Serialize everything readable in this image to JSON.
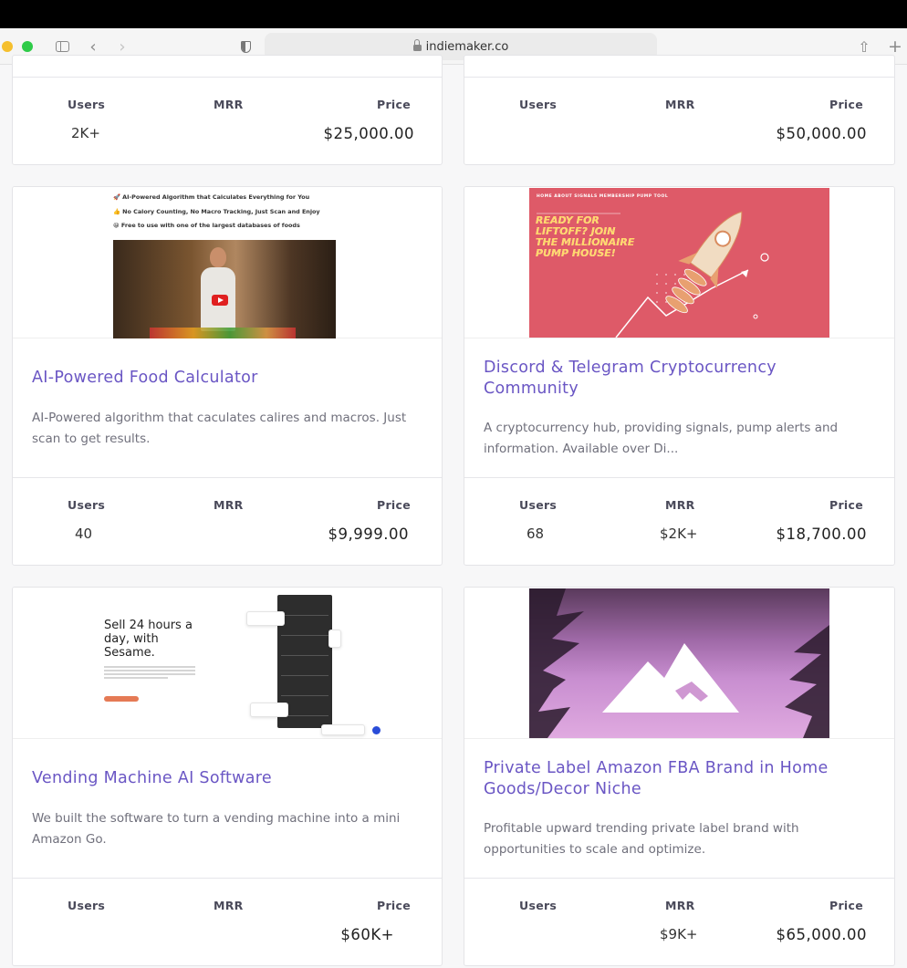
{
  "browser": {
    "url": "indiemaker.co",
    "icons": [
      "sidebar-icon",
      "back-icon",
      "forward-icon",
      "shield-icon",
      "lock-icon",
      "reload-icon",
      "share-icon",
      "new-tab-icon"
    ]
  },
  "stat_labels": {
    "users": "Users",
    "mrr": "MRR",
    "price": "Price"
  },
  "listings": [
    {
      "title": "",
      "description": "",
      "users": "2K+",
      "mrr": "",
      "price": "$25,000.00"
    },
    {
      "title": "",
      "description": "",
      "users": "",
      "mrr": "",
      "price": "$50,000.00"
    },
    {
      "title": "AI-Powered Food Calculator",
      "description": "AI-Powered algorithm that caculates calires and macros. Just scan to get results.",
      "users": "40",
      "mrr": "",
      "price": "$9,999.00",
      "image": {
        "lines": [
          "🚀 AI-Powered Algorithm that Calculates Everything for You",
          "👍 No Calory Counting, No Macro Tracking, Just Scan and Enjoy",
          "😀 Free to use with one of the largest databases of foods"
        ]
      }
    },
    {
      "title": "Discord & Telegram Cryptocurrency Community",
      "description": "A cryptocurrency hub, providing signals, pump alerts and information. Available over Di...",
      "users": "68",
      "mrr": "$2K+",
      "price": "$18,700.00",
      "image": {
        "nav": "HOME    ABOUT    SIGNALS    MEMBERSHIP    PUMP TOOL",
        "headline_lines": [
          "READY FOR",
          "LIFTOFF? JOIN",
          "THE MILLIONAIRE",
          "PUMP HOUSE!"
        ]
      }
    },
    {
      "title": "Vending Machine AI Software",
      "description": "We built the software to turn a vending machine into a mini Amazon Go.",
      "users": "",
      "mrr": "",
      "price": "$60K+",
      "image": {
        "headline_lines": [
          "Sell 24 hours a",
          "day, with",
          "Sesame."
        ]
      }
    },
    {
      "title": "Private Label Amazon FBA Brand in Home Goods/Decor Niche",
      "description": "Profitable upward trending private label brand with opportunities to scale and optimize.",
      "users": "",
      "mrr": "$9K+",
      "price": "$65,000.00"
    }
  ],
  "colors": {
    "title": "#6a56c4",
    "rocket_bg": "#de5a68",
    "rocket_text": "#ffd86a"
  }
}
